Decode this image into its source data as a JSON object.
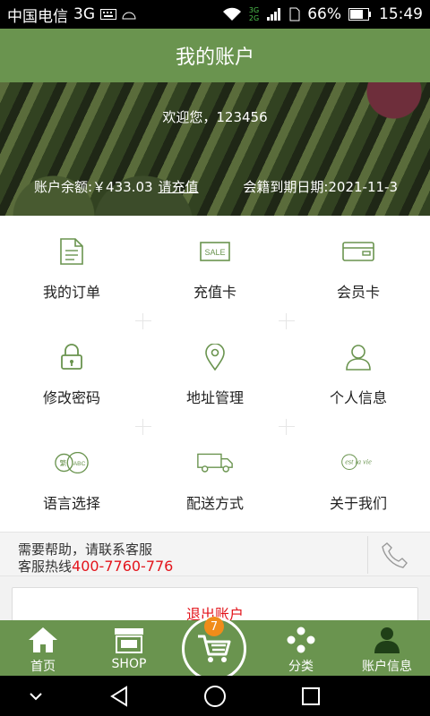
{
  "status_bar": {
    "carrier": "中国电信",
    "network": "3G",
    "net_small_top": "3G",
    "net_small_bottom": "2G",
    "battery": "66%",
    "time": "15:49"
  },
  "header": {
    "title": "我的账户"
  },
  "account": {
    "welcome": "欢迎您，123456",
    "balance": "账户余额:￥433.03",
    "recharge_link": "请充值",
    "expire": "会籍到期日期:2021-11-3"
  },
  "menu": [
    {
      "label": "我的订单",
      "icon": "order-document-icon"
    },
    {
      "label": "充值卡",
      "icon": "sale-card-icon",
      "icon_text": "SALE"
    },
    {
      "label": "会员卡",
      "icon": "member-card-icon"
    },
    {
      "label": "修改密码",
      "icon": "lock-icon"
    },
    {
      "label": "地址管理",
      "icon": "location-pin-icon"
    },
    {
      "label": "个人信息",
      "icon": "user-icon"
    },
    {
      "label": "语言选择",
      "icon": "language-icon",
      "icon_text_left": "繁",
      "icon_text_right": "ABC"
    },
    {
      "label": "配送方式",
      "icon": "delivery-truck-icon"
    },
    {
      "label": "关于我们",
      "icon": "brand-logo-icon",
      "icon_text": "est la vie"
    }
  ],
  "help": {
    "line1": "需要帮助，请联系客服",
    "line2_prefix": "客服热线",
    "hotline": "400-7760-776"
  },
  "logout_label": "退出账户",
  "tabbar": {
    "home": "首页",
    "shop": "SHOP",
    "cart_badge": "7",
    "category": "分类",
    "account": "账户信息"
  },
  "colors": {
    "brand_green": "#6a944f",
    "hotline_red": "#e3141b",
    "badge_orange": "#f08c1a"
  }
}
